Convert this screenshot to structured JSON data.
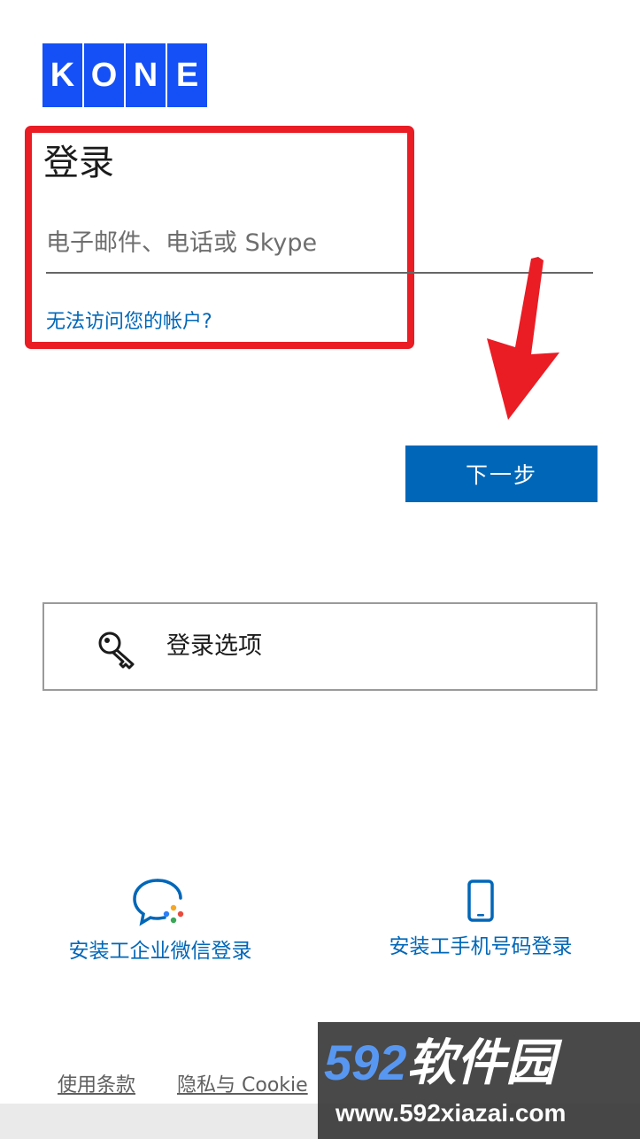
{
  "logo": {
    "letters": [
      "K",
      "O",
      "N",
      "E"
    ],
    "brand_color": "#1450f5"
  },
  "signin": {
    "title": "登录",
    "email_placeholder": "电子邮件、电话或 Skype",
    "email_value": "",
    "forgot_link": "无法访问您的帐户?",
    "next_button": "下一步"
  },
  "sign_in_options": {
    "label": "登录选项",
    "icon": "key-icon"
  },
  "alt_logins": [
    {
      "label": "安装工企业微信登录",
      "icon": "wechat-work-icon"
    },
    {
      "label": "安装工手机号码登录",
      "icon": "mobile-phone-icon"
    }
  ],
  "footer": {
    "terms": "使用条款",
    "privacy": "隐私与 Cookie"
  },
  "watermark": {
    "brand_number": "592",
    "brand_text": "软件园",
    "url": "www.592xiazai.com"
  },
  "colors": {
    "accent": "#0067b8",
    "highlight": "#ea1c24"
  }
}
